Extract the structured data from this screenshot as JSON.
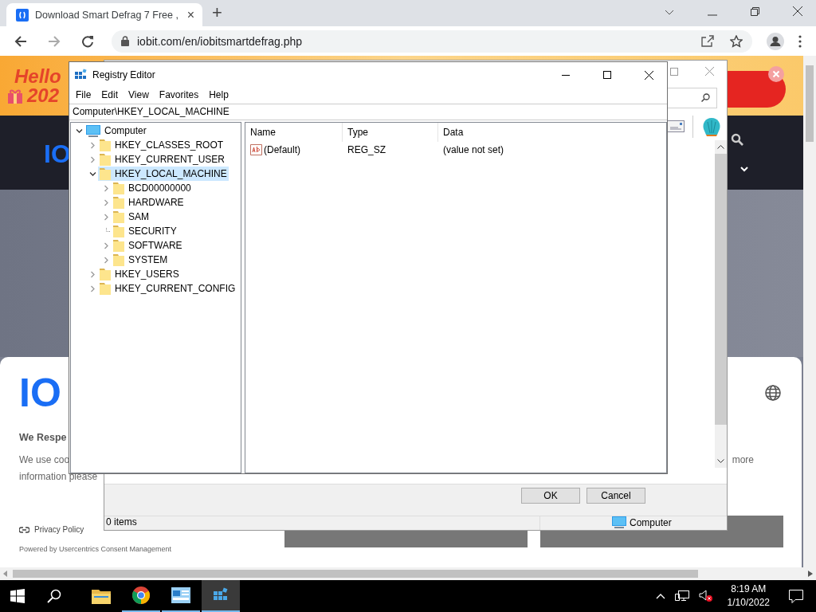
{
  "browser": {
    "tab": {
      "title": "Download Smart Defrag 7 Free ,",
      "close": "×"
    },
    "new_tab": "+",
    "url": "iobit.com/en/iobitsmartdefrag.php"
  },
  "web_page": {
    "banner": {
      "line_1": "Hello",
      "line_2": "202"
    },
    "nav": {
      "logo": "IO"
    },
    "consent": {
      "logo": "IO",
      "heading": "We Respe",
      "text_line_1": "We use coo",
      "text_line_2": "information please",
      "text_more": "more",
      "privacy_link": "Privacy Policy",
      "powered_by": "Powered by Usercentrics Consent Management"
    }
  },
  "background_dialog": {
    "buttons": [
      "OK",
      "Cancel"
    ],
    "status_items": "0 items",
    "status_location": "Computer"
  },
  "registry_editor": {
    "title": "Registry Editor",
    "menu": [
      "File",
      "Edit",
      "View",
      "Favorites",
      "Help"
    ],
    "address": "Computer\\HKEY_LOCAL_MACHINE",
    "tree": [
      {
        "label": "Computer",
        "kind": "computer",
        "expanded": true,
        "selected": false,
        "children": [
          {
            "label": "HKEY_CLASSES_ROOT",
            "kind": "folder",
            "expanded": false,
            "selected": false
          },
          {
            "label": "HKEY_CURRENT_USER",
            "kind": "folder",
            "expanded": false,
            "selected": false
          },
          {
            "label": "HKEY_LOCAL_MACHINE",
            "kind": "folder",
            "expanded": true,
            "selected": true,
            "children": [
              {
                "label": "BCD00000000",
                "kind": "folder",
                "expanded": false,
                "selected": false
              },
              {
                "label": "HARDWARE",
                "kind": "folder",
                "expanded": false,
                "selected": false
              },
              {
                "label": "SAM",
                "kind": "folder",
                "expanded": false,
                "selected": false
              },
              {
                "label": "SECURITY",
                "kind": "folder",
                "selected": false
              },
              {
                "label": "SOFTWARE",
                "kind": "folder",
                "expanded": false,
                "selected": false
              },
              {
                "label": "SYSTEM",
                "kind": "folder",
                "expanded": false,
                "selected": false
              }
            ]
          },
          {
            "label": "HKEY_USERS",
            "kind": "folder",
            "expanded": false,
            "selected": false
          },
          {
            "label": "HKEY_CURRENT_CONFIG",
            "kind": "folder",
            "expanded": false,
            "selected": false
          }
        ]
      }
    ],
    "columns": [
      "Name",
      "Type",
      "Data"
    ],
    "rows": [
      {
        "name": "(Default)",
        "type": "REG_SZ",
        "data": "(value not set)"
      }
    ]
  },
  "taskbar": {
    "apps": [
      {
        "kind": "file-explorer",
        "running": false,
        "selected": false
      },
      {
        "kind": "chrome",
        "running": true,
        "selected": false
      },
      {
        "kind": "control-panel",
        "running": true,
        "selected": false
      },
      {
        "kind": "registry",
        "running": true,
        "selected": true
      }
    ],
    "time": "8:19 AM",
    "date": "1/10/2022"
  }
}
